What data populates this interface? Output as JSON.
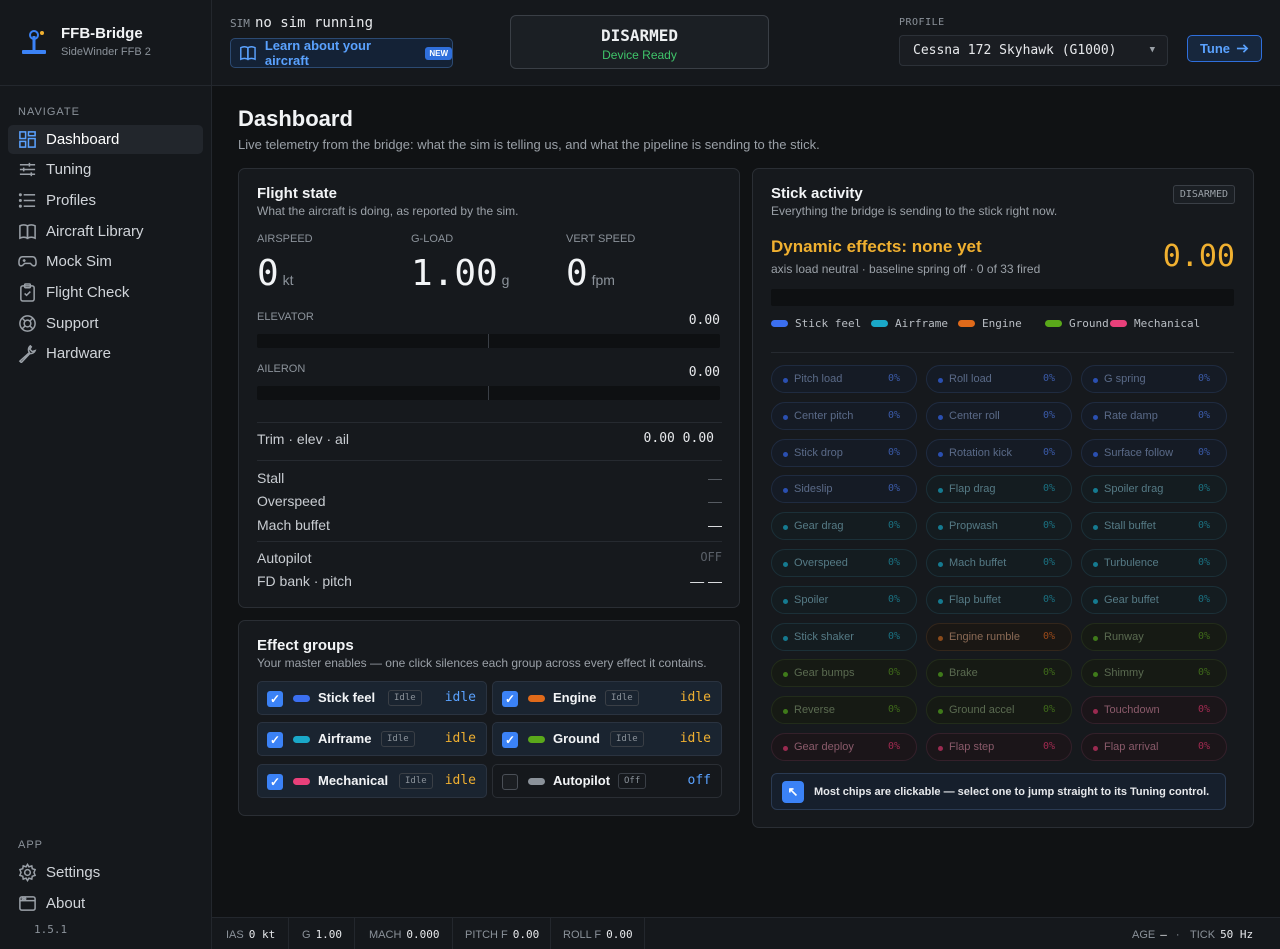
{
  "brand": {
    "title": "FFB-Bridge",
    "subtitle": "SideWinder FFB 2"
  },
  "nav": {
    "section_navigate": "NAVIGATE",
    "items": [
      {
        "label": "Dashboard",
        "icon": "grid-icon",
        "active": true
      },
      {
        "label": "Tuning",
        "icon": "sliders-icon"
      },
      {
        "label": "Profiles",
        "icon": "list-icon"
      },
      {
        "label": "Aircraft Library",
        "icon": "book-icon"
      },
      {
        "label": "Mock Sim",
        "icon": "gamepad-icon"
      },
      {
        "label": "Flight Check",
        "icon": "clipboard-icon"
      },
      {
        "label": "Support",
        "icon": "lifebuoy-icon"
      },
      {
        "label": "Hardware",
        "icon": "wrench-icon"
      }
    ],
    "section_app": "APP",
    "app_items": [
      {
        "label": "Settings",
        "icon": "gear-icon"
      },
      {
        "label": "About",
        "icon": "window-icon"
      }
    ],
    "version": "1.5.1"
  },
  "topbar": {
    "sim_label": "SIM",
    "sim_value": "no sim running",
    "learn_label": "Learn about your aircraft",
    "learn_badge": "NEW",
    "arm_state": "DISARMED",
    "arm_sub": "Device Ready",
    "profile_label": "PROFILE",
    "profile_value": "Cessna 172 Skyhawk (G1000)",
    "tune_label": "Tune"
  },
  "page": {
    "title": "Dashboard",
    "subtitle": "Live telemetry from the bridge: what the sim is telling us, and what the pipeline is sending to the stick."
  },
  "flight": {
    "title": "Flight state",
    "sub": "What the aircraft is doing, as reported by the sim.",
    "airspeed_label": "AIRSPEED",
    "airspeed": "0",
    "airspeed_unit": "kt",
    "gload_label": "G-LOAD",
    "gload": "1.00",
    "gload_unit": "g",
    "vs_label": "VERT SPEED",
    "vs": "0",
    "vs_unit": "fpm",
    "elevator_label": "ELEVATOR",
    "elevator": "0.00",
    "aileron_label": "AILERON",
    "aileron": "0.00",
    "trim_label": "Trim · elev · ail",
    "trim_value": "0.00 0.00",
    "stall_label": "Stall",
    "stall_value": "—",
    "overspeed_label": "Overspeed",
    "overspeed_value": "—",
    "mach_label": "Mach buffet",
    "mach_value": "—",
    "ap_label": "Autopilot",
    "ap_value": "OFF",
    "fd_label": "FD bank · pitch",
    "fd_value": "— —"
  },
  "groups": {
    "title": "Effect groups",
    "sub": "Your master enables — one click silences each group across every effect it contains.",
    "items": [
      {
        "name": "Stick feel",
        "tag": "Idle",
        "state": "idle",
        "color": "#3b6ff0",
        "state_color": "#5aa2ff",
        "checked": true
      },
      {
        "name": "Engine",
        "tag": "Idle",
        "state": "idle",
        "color": "#e06a1a",
        "state_color": "#f0b030",
        "checked": true
      },
      {
        "name": "Airframe",
        "tag": "Idle",
        "state": "idle",
        "color": "#1aa8c8",
        "state_color": "#f0b030",
        "checked": true
      },
      {
        "name": "Ground",
        "tag": "Idle",
        "state": "idle",
        "color": "#5aa81a",
        "state_color": "#f0b030",
        "checked": true
      },
      {
        "name": "Mechanical",
        "tag": "Idle",
        "state": "idle",
        "color": "#e8407a",
        "state_color": "#f0b030",
        "checked": true
      },
      {
        "name": "Autopilot",
        "tag": "Off",
        "state": "off",
        "color": "#8b929a",
        "state_color": "#5aa2ff",
        "checked": false
      }
    ]
  },
  "stick": {
    "title": "Stick activity",
    "sub": "Everything the bridge is sending to the stick right now.",
    "badge": "DISARMED",
    "dyn_title": "Dynamic effects: none yet",
    "dyn_sub": "axis load neutral · baseline spring off · 0 of 33 fired",
    "dyn_value": "0.00",
    "legend": [
      {
        "label": "Stick feel",
        "color": "#3b6ff0"
      },
      {
        "label": "Airframe",
        "color": "#1aa8c8"
      },
      {
        "label": "Engine",
        "color": "#e06a1a"
      },
      {
        "label": "Ground",
        "color": "#5aa81a"
      },
      {
        "label": "Mechanical",
        "color": "#e8407a"
      }
    ],
    "chips": [
      {
        "name": "Pitch load",
        "pct": "0%",
        "g": "s"
      },
      {
        "name": "Roll load",
        "pct": "0%",
        "g": "s"
      },
      {
        "name": "G spring",
        "pct": "0%",
        "g": "s"
      },
      {
        "name": "Center pitch",
        "pct": "0%",
        "g": "s"
      },
      {
        "name": "Center roll",
        "pct": "0%",
        "g": "s"
      },
      {
        "name": "Rate damp",
        "pct": "0%",
        "g": "s"
      },
      {
        "name": "Stick drop",
        "pct": "0%",
        "g": "s"
      },
      {
        "name": "Rotation kick",
        "pct": "0%",
        "g": "s"
      },
      {
        "name": "Surface follow",
        "pct": "0%",
        "g": "s"
      },
      {
        "name": "Sideslip",
        "pct": "0%",
        "g": "s"
      },
      {
        "name": "Flap drag",
        "pct": "0%",
        "g": "a"
      },
      {
        "name": "Spoiler drag",
        "pct": "0%",
        "g": "a"
      },
      {
        "name": "Gear drag",
        "pct": "0%",
        "g": "a"
      },
      {
        "name": "Propwash",
        "pct": "0%",
        "g": "a"
      },
      {
        "name": "Stall buffet",
        "pct": "0%",
        "g": "a"
      },
      {
        "name": "Overspeed",
        "pct": "0%",
        "g": "a"
      },
      {
        "name": "Mach buffet",
        "pct": "0%",
        "g": "a"
      },
      {
        "name": "Turbulence",
        "pct": "0%",
        "g": "a"
      },
      {
        "name": "Spoiler",
        "pct": "0%",
        "g": "a"
      },
      {
        "name": "Flap buffet",
        "pct": "0%",
        "g": "a"
      },
      {
        "name": "Gear buffet",
        "pct": "0%",
        "g": "a"
      },
      {
        "name": "Stick shaker",
        "pct": "0%",
        "g": "a"
      },
      {
        "name": "Engine rumble",
        "pct": "0%",
        "g": "e"
      },
      {
        "name": "Runway",
        "pct": "0%",
        "g": "n"
      },
      {
        "name": "Gear bumps",
        "pct": "0%",
        "g": "n"
      },
      {
        "name": "Brake",
        "pct": "0%",
        "g": "n"
      },
      {
        "name": "Shimmy",
        "pct": "0%",
        "g": "n"
      },
      {
        "name": "Reverse",
        "pct": "0%",
        "g": "n"
      },
      {
        "name": "Ground accel",
        "pct": "0%",
        "g": "n"
      },
      {
        "name": "Touchdown",
        "pct": "0%",
        "g": "m"
      },
      {
        "name": "Gear deploy",
        "pct": "0%",
        "g": "m"
      },
      {
        "name": "Flap step",
        "pct": "0%",
        "g": "m"
      },
      {
        "name": "Flap arrival",
        "pct": "0%",
        "g": "m"
      }
    ],
    "hint": "Most chips are clickable — select one to jump straight to its Tuning control."
  },
  "status": {
    "ias_label": "IAS",
    "ias": "0 kt",
    "g_label": "G",
    "g": "1.00",
    "mach_label": "MACH",
    "mach": "0.000",
    "pitchf_label": "PITCH F",
    "pitchf": "0.00",
    "rollf_label": "ROLL F",
    "rollf": "0.00",
    "age_label": "AGE",
    "age": "—",
    "tick_label": "TICK",
    "tick": "50 Hz"
  }
}
